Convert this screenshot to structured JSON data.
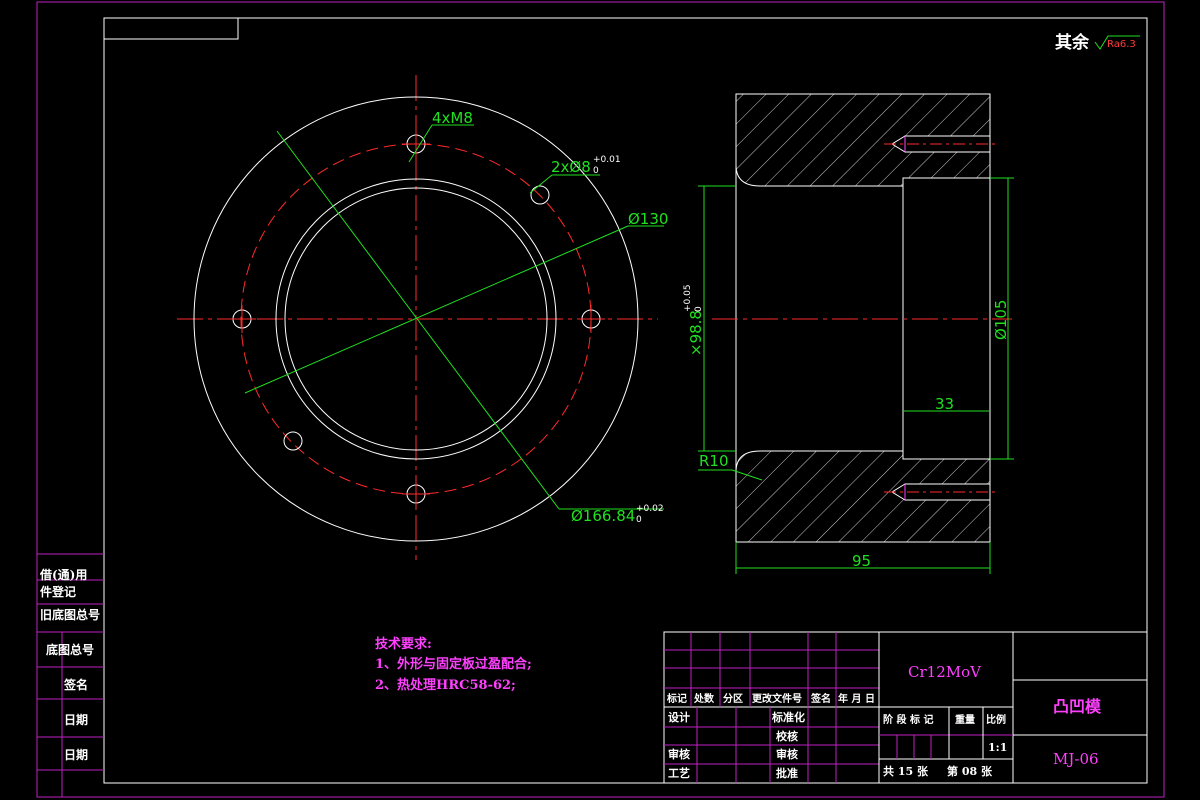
{
  "drawing": {
    "roughness_note": "其余",
    "roughness_value": "Ra6.3",
    "front_view": {
      "hole_thread": "4xM8",
      "hole_pin": "2xØ8",
      "hole_pin_tol": "+0.01",
      "hole_pin_tol_low": "0",
      "dia_inner": "Ø130",
      "dia_pcd": "Ø166.84",
      "dia_pcd_tol": "+0.02",
      "dia_pcd_tol_low": "0"
    },
    "section_view": {
      "dia_bore": "×98.8",
      "dia_bore_tol": "+0.05",
      "dia_bore_tol_low": "0",
      "dia_counterbore": "Ø105",
      "depth_33": "33",
      "radius": "R10",
      "length_95": "95"
    },
    "tech_requirements": {
      "title": "技术要求:",
      "line1": "1、外形与固定板过盈配合;",
      "line2": "2、热处理HRC58-62;"
    },
    "left_stamp": [
      "借(通)用",
      "件登记",
      "旧底图总号",
      "底图总号",
      "签名",
      "日期",
      "日期"
    ],
    "title_block": {
      "material": "Cr12MoV",
      "part_name": "凸凹模",
      "drawing_no": "MJ-06",
      "scale": "1:1",
      "sheets_total": "共 15 张",
      "sheet_no": "第 08 张",
      "rev_headers": [
        "标记",
        "处数",
        "分区",
        "更改文件号",
        "签名",
        "年 月 日"
      ],
      "design": "设计",
      "standardize": "标准化",
      "check": "审核",
      "process": "工艺",
      "proof": "校核",
      "approve_mid": "审核",
      "approve": "批准",
      "stage_label": "阶 段 标 记",
      "weight_label": "重量",
      "ratio_label": "比例"
    }
  }
}
